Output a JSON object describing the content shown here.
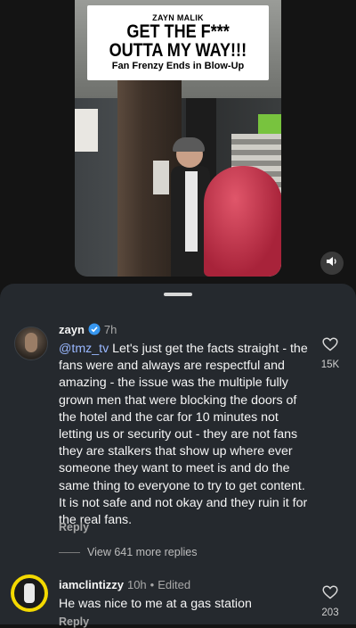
{
  "video": {
    "caption_small": "ZAYN MALIK",
    "caption_line1": "GET THE F***",
    "caption_line2": "OUTTA MY WAY!!!",
    "caption_sub": "Fan Frenzy Ends in Blow-Up"
  },
  "icons": {
    "mute": "speaker-icon",
    "verified": "verified-badge-icon",
    "like": "heart-icon"
  },
  "colors": {
    "sheet_bg": "#25292e",
    "mention": "#9ab8ff",
    "verified": "#3797f0",
    "avatar_ring": "#f4d900"
  },
  "comments": [
    {
      "username": "zayn",
      "time": "7h",
      "mention": "@tmz_tv",
      "text": " Let's just get the facts straight - the fans were and always are respectful and amazing - the issue was the multiple fully grown men that were blocking the doors of the hotel and the car for 10 minutes not letting us or security out - they are not fans they are stalkers that show up where ever someone they want to meet is and do the same thing to everyone to try to get content. It is not safe and not okay and they ruin it for the real fans.",
      "reply_label": "Reply",
      "like_count": "15K",
      "view_replies": "View 641 more replies"
    },
    {
      "username": "iamclintizzy",
      "time": "10h",
      "edited": "Edited",
      "text": "He was nice to me at a gas station",
      "reply_label": "Reply",
      "like_count": "203"
    }
  ]
}
